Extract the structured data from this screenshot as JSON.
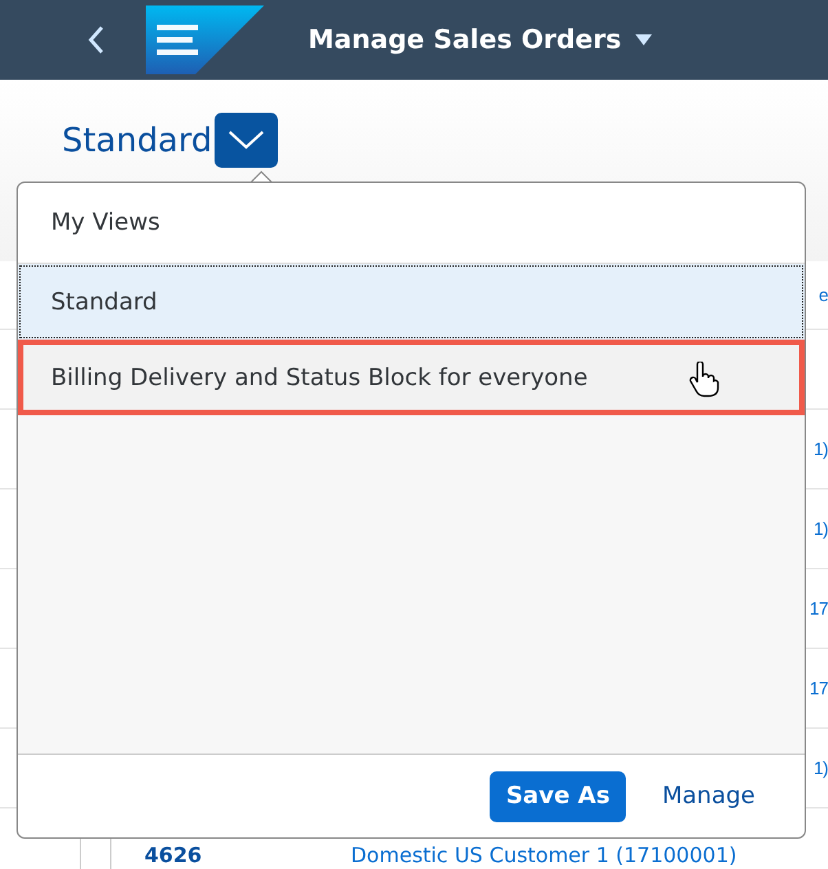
{
  "shell": {
    "title": "Manage Sales Orders"
  },
  "variant": {
    "title": "Standard"
  },
  "table": {
    "rows": [
      {
        "column_3": "e"
      },
      {},
      {
        "column_3": "1)"
      },
      {
        "column_3": "1)"
      },
      {
        "column_3": "17"
      },
      {
        "column_3": "17"
      },
      {
        "column_3": "1)"
      },
      {
        "column_1": "4626",
        "column_2": "Domestic US Customer 1 (17100001)"
      }
    ]
  },
  "popover": {
    "title": "My Views",
    "items": [
      {
        "label": "Standard",
        "selected": true,
        "hovered": false,
        "highlighted": false
      },
      {
        "label": "Billing Delivery and Status Block for everyone",
        "selected": false,
        "hovered": true,
        "highlighted": true
      }
    ],
    "buttons": [
      {
        "label": "Save As",
        "kind": "emphasized"
      },
      {
        "label": "Manage",
        "kind": "transparent"
      }
    ]
  }
}
